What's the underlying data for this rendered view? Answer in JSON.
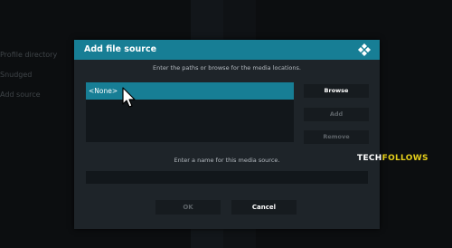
{
  "background": {
    "menu_items": [
      "Profile directory",
      "Snudged",
      "Add source"
    ]
  },
  "dialog": {
    "title": "Add file source",
    "paths_instruction": "Enter the paths or browse for the media locations.",
    "paths": [
      {
        "label": "<None>",
        "selected": true
      }
    ],
    "browse_label": "Browse",
    "add_label": "Add",
    "remove_label": "Remove",
    "name_instruction": "Enter a name for this media source.",
    "name_value": "",
    "ok_label": "OK",
    "cancel_label": "Cancel"
  },
  "watermark": {
    "part1": "TECH",
    "part2": "FOLLOWS"
  },
  "colors": {
    "accent": "#177e95",
    "dialog_bg": "#1e2429",
    "watermark_tech": "#ffffff",
    "watermark_follows": "#e5cf1a",
    "enabled_text": "#ffffff",
    "disabled_text": "#5d6368"
  },
  "icons": {
    "header": "kodi-logo-icon",
    "pointer": "mouse-cursor-icon"
  }
}
